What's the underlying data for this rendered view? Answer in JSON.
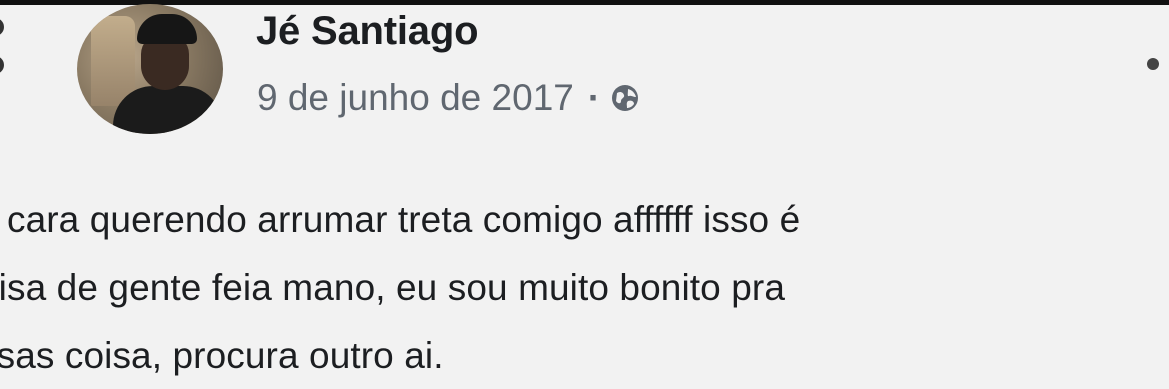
{
  "post": {
    "author_name": "Jé Santiago",
    "date": "9 de junho de 2017",
    "separator": "·",
    "privacy_icon": "globe-icon",
    "menu_icon": "more-options-icon",
    "text_lines": [
      "s cara querendo arrumar treta comigo affffff isso é",
      "oisa de gente feia mano, eu sou muito bonito pra",
      "ssas coisa, procura outro ai."
    ]
  }
}
